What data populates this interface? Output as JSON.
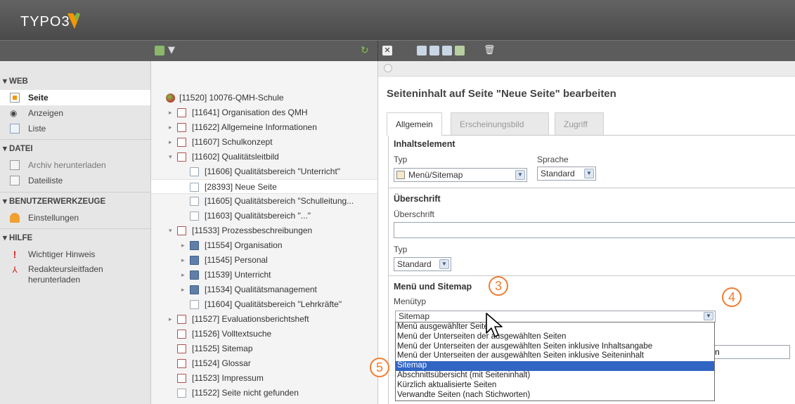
{
  "app": {
    "logo_text": "TYPO3",
    "brand_color": "#f49700"
  },
  "modules": {
    "groups": [
      {
        "title": "▾ WEB",
        "items": [
          {
            "label": "Seite",
            "icon": "page-icon",
            "active": true
          },
          {
            "label": "Anzeigen",
            "icon": "eye-icon"
          },
          {
            "label": "Liste",
            "icon": "list-icon"
          }
        ]
      },
      {
        "title": "▾ DATEI",
        "items": [
          {
            "label": "Archiv herunterladen",
            "icon": "archive-icon"
          },
          {
            "label": "Dateiliste",
            "icon": "folder-icon"
          }
        ]
      },
      {
        "title": "▾ BENUTZERWERKZEUGE",
        "items": [
          {
            "label": "Einstellungen",
            "icon": "users-icon"
          }
        ]
      },
      {
        "title": "▾ HILFE",
        "items": [
          {
            "label": "Wichtiger Hinweis",
            "icon": "exclamation-icon"
          },
          {
            "label": "Redakteursleitfaden",
            "label2": "herunterladen",
            "icon": "pdf-icon"
          }
        ]
      }
    ]
  },
  "tree": {
    "nodes": [
      "[11520] 10076-QMH-Schule",
      "[11641] Organisation des QMH",
      "[11622] Allgemeine Informationen",
      "[11607] Schulkonzept",
      "[11602] Qualitätsleitbild",
      "[11606] Qualitätsbereich \"Unterricht\"",
      "[28393] Neue Seite",
      "[11605] Qualitätsbereich \"Schulleitung...",
      "[11603] Qualitätsbereich \"...\"",
      "[11533] Prozessbeschreibungen",
      "[11554] Organisation",
      "[11545] Personal",
      "[11539] Unterricht",
      "[11534] Qualitätsmanagement",
      "[11604] Qualitätsbereich \"Lehrkräfte\"",
      "[11527] Evaluationsberichtsheft",
      "[11526] Volltextsuche",
      "[11525] Sitemap",
      "[11524] Glossar",
      "[11523] Impressum",
      "[11522] Seite nicht gefunden"
    ]
  },
  "main": {
    "title": "Seiteninhalt auf Seite \"Neue Seite\" bearbeiten",
    "tabs": [
      "Allgemein",
      "Erscheinungsbild",
      "Zugriff"
    ],
    "inhalt": {
      "section": "Inhaltselement",
      "typ_label": "Typ",
      "typ_value": "Menü/Sitemap",
      "sprache_label": "Sprache",
      "sprache_value": "Standard"
    },
    "ueberschrift": {
      "section": "Überschrift",
      "field_label": "Überschrift",
      "field_value": "",
      "typ_label": "Typ",
      "typ_value": "Standard"
    },
    "menu": {
      "section": "Menü und Sitemap",
      "menutyp_label": "Menütyp",
      "menutyp_value": "Sitemap",
      "options": [
        "Menü ausgewählter Seiten",
        "Menü der Unterseiten der ausgewählten Seiten",
        "Menü der Unterseiten der ausgewählten Seiten inklusive Inhaltsangabe",
        "Menü der Unterseiten der ausgewählten Seiten inklusive Seiteninhalt",
        "Sitemap",
        "Abschnittsübersicht (mit Seiteninhalt)",
        "Kürzlich aktualisierte Seiten",
        "Verwandte Seiten (nach Stichworten)"
      ],
      "selected_index": 4,
      "hidden_field_tail": "n"
    }
  },
  "callouts": [
    "3",
    "4",
    "5"
  ],
  "colors": {
    "callout": "#ef7d31",
    "selection": "#3165c4"
  }
}
